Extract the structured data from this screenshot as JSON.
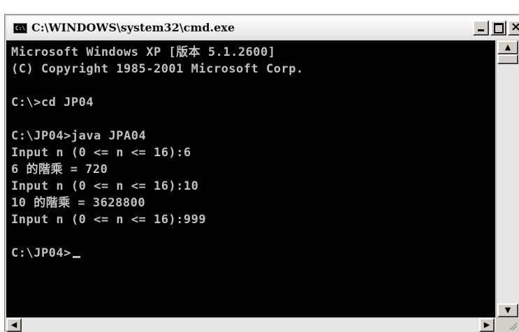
{
  "window": {
    "title": "C:\\WINDOWS\\system32\\cmd.exe",
    "icon": "cmd-icon",
    "icon_text": "C:\\",
    "buttons": {
      "minimize_icon": "minimize-icon",
      "maximize_icon": "maximize-icon",
      "close": "×"
    }
  },
  "console": {
    "lines": [
      "Microsoft Windows XP [版本 5.1.2600]",
      "(C) Copyright 1985-2001 Microsoft Corp.",
      "",
      "C:\\>cd JP04",
      "",
      "C:\\JP04>java JPA04",
      "Input n (0 <= n <= 16):6",
      "6 的階乘 = 720",
      "Input n (0 <= n <= 16):10",
      "10 的階乘 = 3628800",
      "Input n (0 <= n <= 16):999",
      "",
      "C:\\JP04>"
    ],
    "colors": {
      "background": "#000000",
      "text": "#c0c0c0"
    }
  },
  "scrollbar": {
    "up": "▲",
    "down": "▼",
    "left": "◀",
    "right": "▶"
  }
}
